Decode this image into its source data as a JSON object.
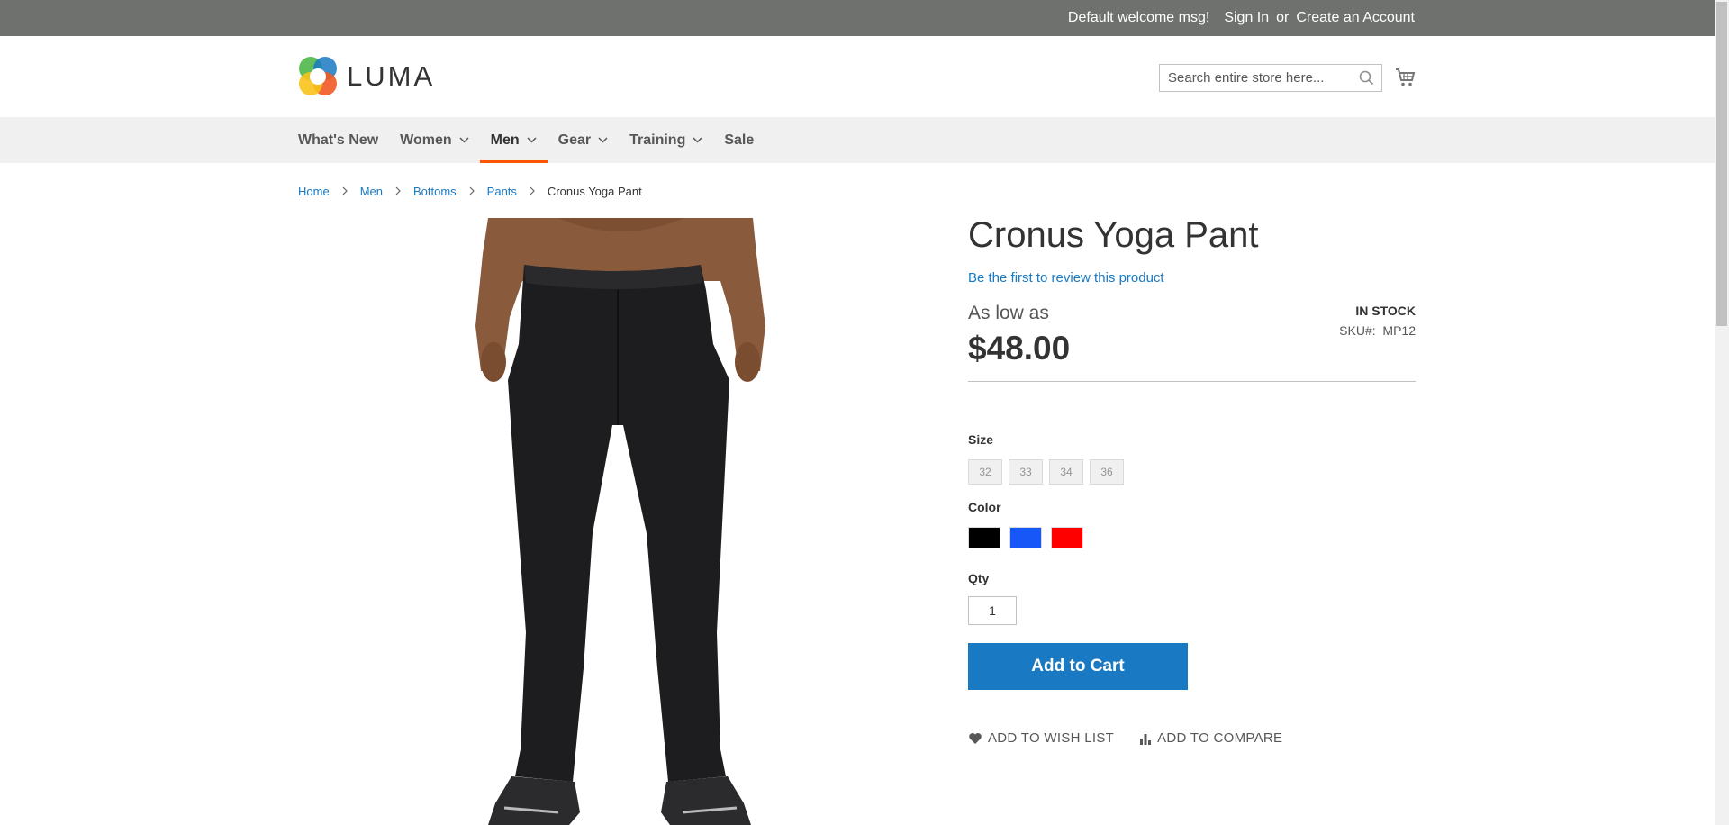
{
  "topbar": {
    "welcome": "Default welcome msg!",
    "sign_in": "Sign In",
    "or": "or",
    "create_account": "Create an Account"
  },
  "header": {
    "logo_text": "LUMA",
    "search_placeholder": "Search entire store here...",
    "search_icon": "search-icon",
    "cart_icon": "cart-icon"
  },
  "nav": {
    "items": [
      {
        "label": "What's New",
        "dropdown": false
      },
      {
        "label": "Women",
        "dropdown": true
      },
      {
        "label": "Men",
        "dropdown": true,
        "active": true
      },
      {
        "label": "Gear",
        "dropdown": true
      },
      {
        "label": "Training",
        "dropdown": true
      },
      {
        "label": "Sale",
        "dropdown": false
      }
    ],
    "active_color": "#ff5501"
  },
  "breadcrumbs": [
    {
      "label": "Home"
    },
    {
      "label": "Men"
    },
    {
      "label": "Bottoms"
    },
    {
      "label": "Pants"
    },
    {
      "label": "Cronus Yoga Pant"
    }
  ],
  "product": {
    "title": "Cronus Yoga Pant",
    "review_link": "Be the first to review this product",
    "as_low_as": "As low as",
    "price": "$48.00",
    "stock": "In stock",
    "sku_label": "SKU#:",
    "sku": "MP12",
    "size_label": "Size",
    "sizes": [
      "32",
      "33",
      "34",
      "36"
    ],
    "color_label": "Color",
    "colors": [
      {
        "name": "Black",
        "hex": "#000000"
      },
      {
        "name": "Blue",
        "hex": "#1857f7"
      },
      {
        "name": "Red",
        "hex": "#ff0000"
      }
    ],
    "qty_label": "Qty",
    "qty": "1",
    "add_to_cart": "Add to Cart",
    "wishlist": "Add to Wish List",
    "compare": "Add to Compare"
  },
  "colors": {
    "link": "#1979c3",
    "button": "#1979c3",
    "topbar": "#6e716e"
  }
}
